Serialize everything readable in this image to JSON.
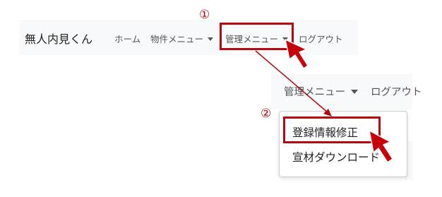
{
  "navbar": {
    "brand": "無人内見くん",
    "links": {
      "home": "ホーム",
      "property_menu": "物件メニュー",
      "admin_menu": "管理メニュー",
      "logout": "ログアウト"
    }
  },
  "zoom": {
    "admin_menu": "管理メニュー",
    "logout": "ログアウト"
  },
  "dropdown": {
    "items": [
      "登録情報修正",
      "宣材ダウンロード"
    ]
  },
  "annotations": {
    "step1": "①",
    "step2": "②",
    "highlight_color": "#b4070f"
  }
}
